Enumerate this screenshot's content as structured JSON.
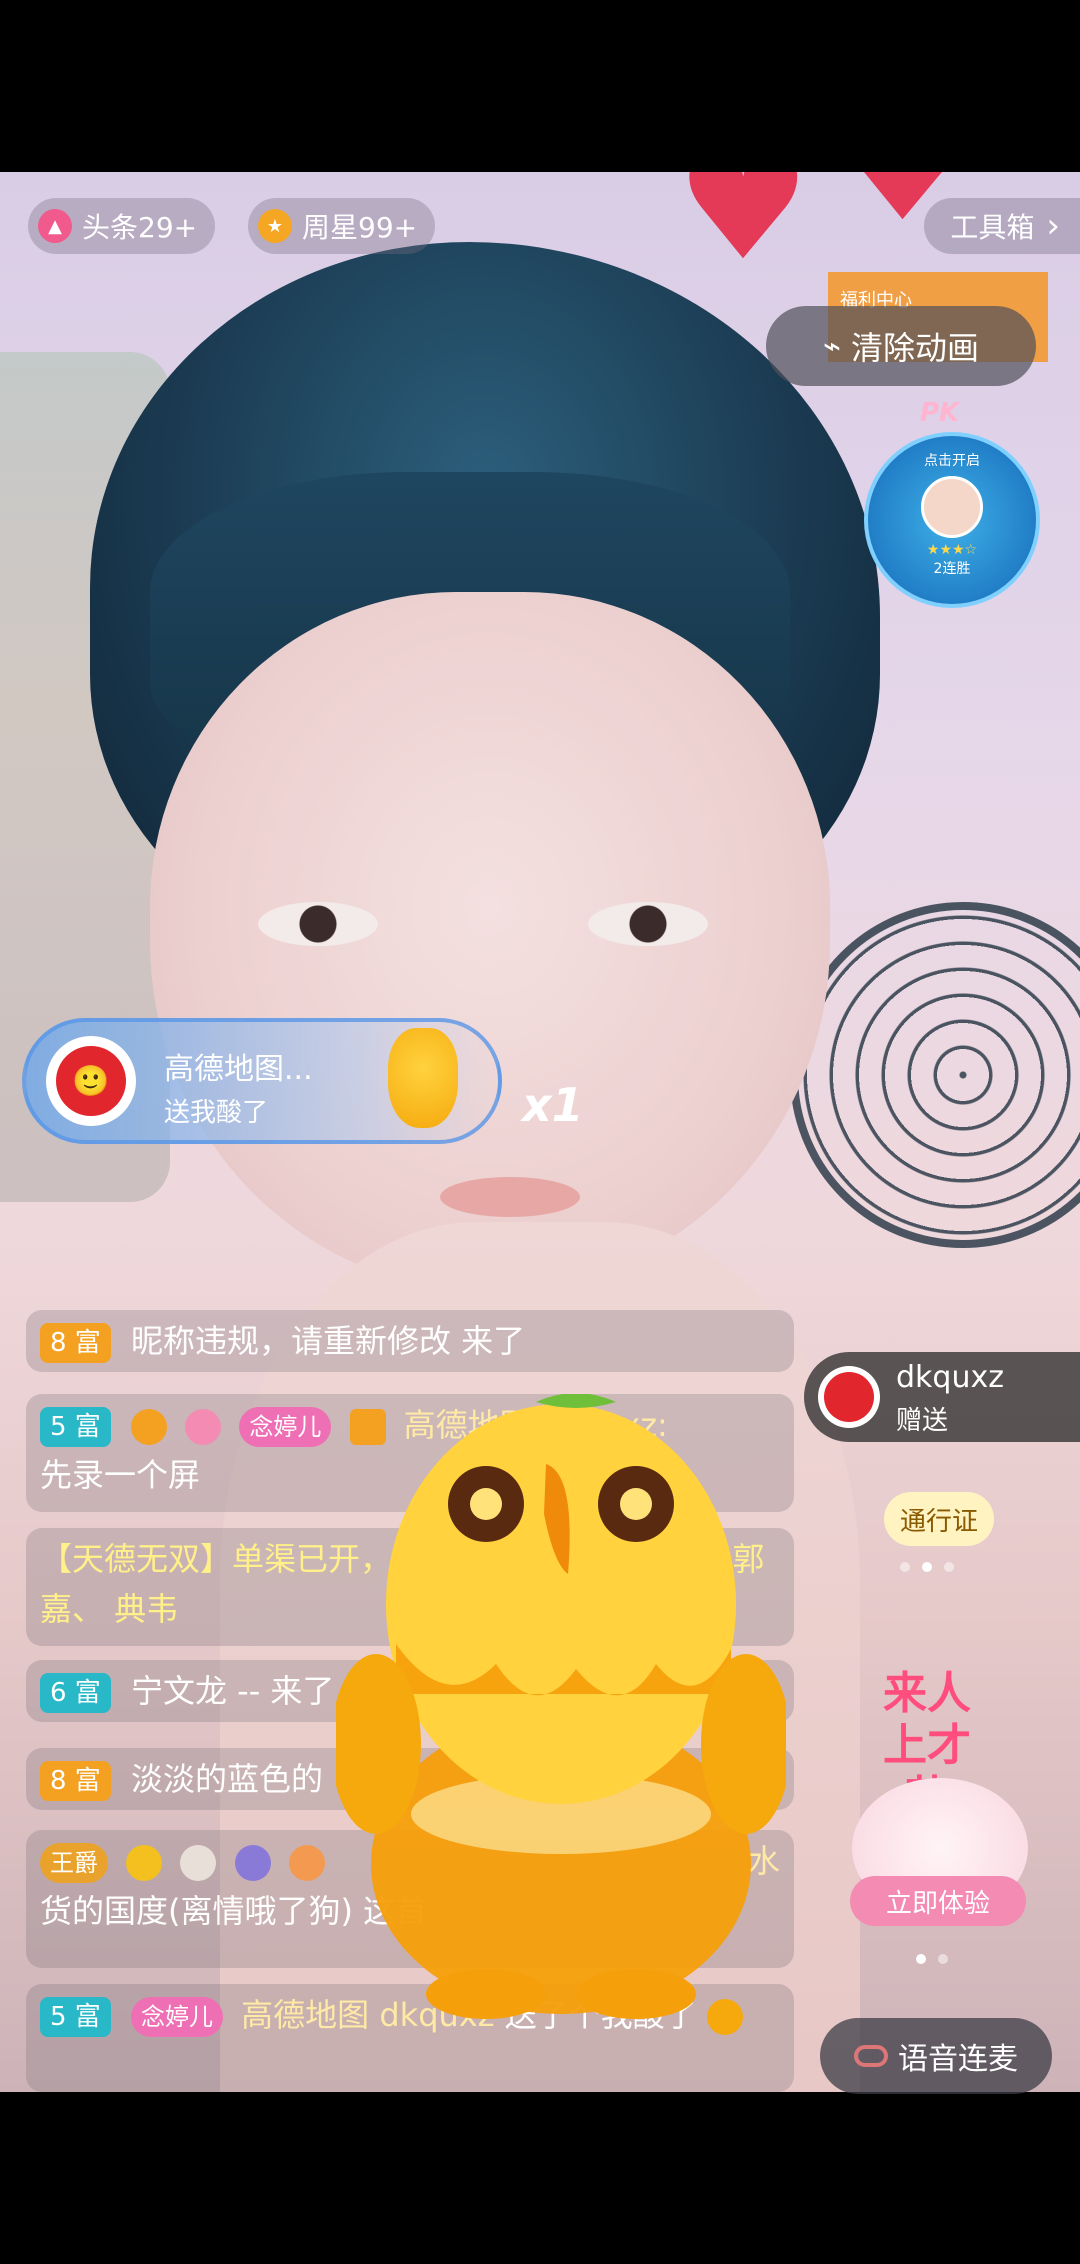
{
  "top_bar": {
    "headline_label": "头条29+",
    "weekly_star_label": "周星99+",
    "toolbox_label": "工具箱",
    "toolbox_chevron": "›"
  },
  "right_panel": {
    "welfare_label": "福利中心",
    "clear_animation_label": "清除动画",
    "pk_tag": "PK",
    "pk_title": "点击开启",
    "pk_stars": "★★★☆",
    "pk_status": "2连胜"
  },
  "gift_banner": {
    "sender_name": "高德地图...",
    "gift_text": "送我酸了",
    "count": "x1",
    "avatar_glyph": "🙂"
  },
  "chat": [
    {
      "level": "8 富",
      "level_color": "orange",
      "text": "昵称违规，请重新修改 来了"
    },
    {
      "level": "5 富",
      "level_color": "teal",
      "badge": "念婷儿",
      "text_a": "高德地图",
      "text_b": "dkquxz:",
      "text_c": "先录一个屏"
    },
    {
      "system_text": "【天德无双】单渠已开，大元帅，吕布 司马懿、 郭嘉、 典韦"
    },
    {
      "level": "6 富",
      "level_color": "teal",
      "text": "宁文龙 -- 来了"
    },
    {
      "level": "8 富",
      "level_color": "orange",
      "text": "淡淡的蓝色的"
    },
    {
      "badge": "王爵",
      "text_a": "水",
      "text_c": "货的国度(离情哦了狗) 这首"
    },
    {
      "level": "5 富",
      "level_color": "teal",
      "badge": "念婷儿",
      "text_a": "高德地图",
      "text_b": "dkquxz",
      "text_c": "送了个我酸了"
    }
  ],
  "send_notice": {
    "name": "dkquxz",
    "action": "赠送"
  },
  "side": {
    "pass_label": "通行证",
    "talent_line1": "来人",
    "talent_line2": "上才艺",
    "try_label": "立即体验",
    "voice_label": "语音连麦"
  },
  "colors": {
    "level_orange": "#f4a020",
    "level_teal": "#28b8c8",
    "accent_pink": "#ee6fb4",
    "banner_blue": "#5a96e6"
  },
  "icons": [
    "fire-icon",
    "star-icon",
    "broom-icon",
    "avatar-icon",
    "chick-gift-icon",
    "chain-link-icon",
    "heart-icon"
  ]
}
